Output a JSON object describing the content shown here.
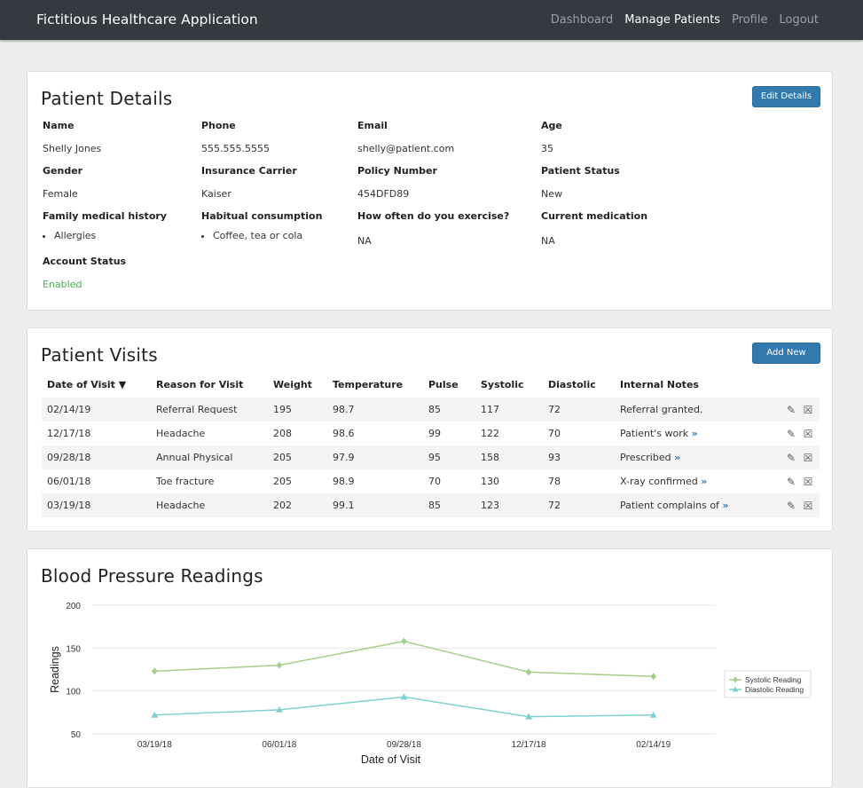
{
  "nav": {
    "brand": "Fictitious Healthcare Application",
    "links": [
      "Dashboard",
      "Manage Patients",
      "Profile",
      "Logout"
    ]
  },
  "patient_details": {
    "title": "Patient Details",
    "edit_button": "Edit Details",
    "fields": {
      "name": {
        "label": "Name",
        "value": "Shelly Jones"
      },
      "phone": {
        "label": "Phone",
        "value": "555.555.5555"
      },
      "email": {
        "label": "Email",
        "value": "shelly@patient.com"
      },
      "age": {
        "label": "Age",
        "value": "35"
      },
      "gender": {
        "label": "Gender",
        "value": "Female"
      },
      "insurance": {
        "label": "Insurance Carrier",
        "value": "Kaiser"
      },
      "policy": {
        "label": "Policy Number",
        "value": "454DFD89"
      },
      "status": {
        "label": "Patient Status",
        "value": "New"
      },
      "family_history": {
        "label": "Family medical history",
        "items": [
          "Allergies"
        ]
      },
      "habitual": {
        "label": "Habitual consumption",
        "items": [
          "Coffee, tea or cola"
        ]
      },
      "exercise": {
        "label": "How often do you exercise?",
        "value": "NA"
      },
      "medication": {
        "label": "Current medication",
        "value": "NA"
      },
      "account_status": {
        "label": "Account Status",
        "value": "Enabled"
      }
    }
  },
  "visits": {
    "title": "Patient Visits",
    "add_button": "Add New",
    "columns": [
      "Date of Visit",
      "Reason for Visit",
      "Weight",
      "Temperature",
      "Pulse",
      "Systolic",
      "Diastolic",
      "Internal Notes"
    ],
    "sort_indicator": "▼",
    "more_glyph": "»",
    "rows": [
      {
        "date": "02/14/19",
        "reason": "Referral Request",
        "weight": "195",
        "temp": "98.7",
        "pulse": "85",
        "systolic": "117",
        "diastolic": "72",
        "notes": "Referral granted.",
        "more": false
      },
      {
        "date": "12/17/18",
        "reason": "Headache",
        "weight": "208",
        "temp": "98.6",
        "pulse": "99",
        "systolic": "122",
        "diastolic": "70",
        "notes": "Patient's work",
        "more": true
      },
      {
        "date": "09/28/18",
        "reason": "Annual Physical",
        "weight": "205",
        "temp": "97.9",
        "pulse": "95",
        "systolic": "158",
        "diastolic": "93",
        "notes": "Prescribed",
        "more": true
      },
      {
        "date": "06/01/18",
        "reason": "Toe fracture",
        "weight": "205",
        "temp": "98.9",
        "pulse": "70",
        "systolic": "130",
        "diastolic": "78",
        "notes": "X-ray confirmed",
        "more": true
      },
      {
        "date": "03/19/18",
        "reason": "Headache",
        "weight": "202",
        "temp": "99.1",
        "pulse": "85",
        "systolic": "123",
        "diastolic": "72",
        "notes": "Patient complains of",
        "more": true
      }
    ],
    "row_icons": [
      "pencil-icon",
      "close-box-icon"
    ]
  },
  "bp_chart": {
    "title": "Blood Pressure Readings"
  },
  "chart_data": {
    "type": "line",
    "x": [
      "03/19/18",
      "06/01/18",
      "09/28/18",
      "12/17/18",
      "02/14/19"
    ],
    "series": [
      {
        "name": "Systolic Reading",
        "values": [
          123,
          130,
          158,
          122,
          117
        ],
        "color": "#a6cf8a",
        "marker": "diamond"
      },
      {
        "name": "Diastolic Reading",
        "values": [
          72,
          78,
          93,
          70,
          72
        ],
        "color": "#80d0d0",
        "marker": "triangle"
      }
    ],
    "xlabel": "Date of Visit",
    "ylabel": "Readings",
    "ylim": [
      50,
      200
    ],
    "yticks": [
      50,
      100,
      150,
      200
    ],
    "grid": true,
    "legend": "right"
  }
}
